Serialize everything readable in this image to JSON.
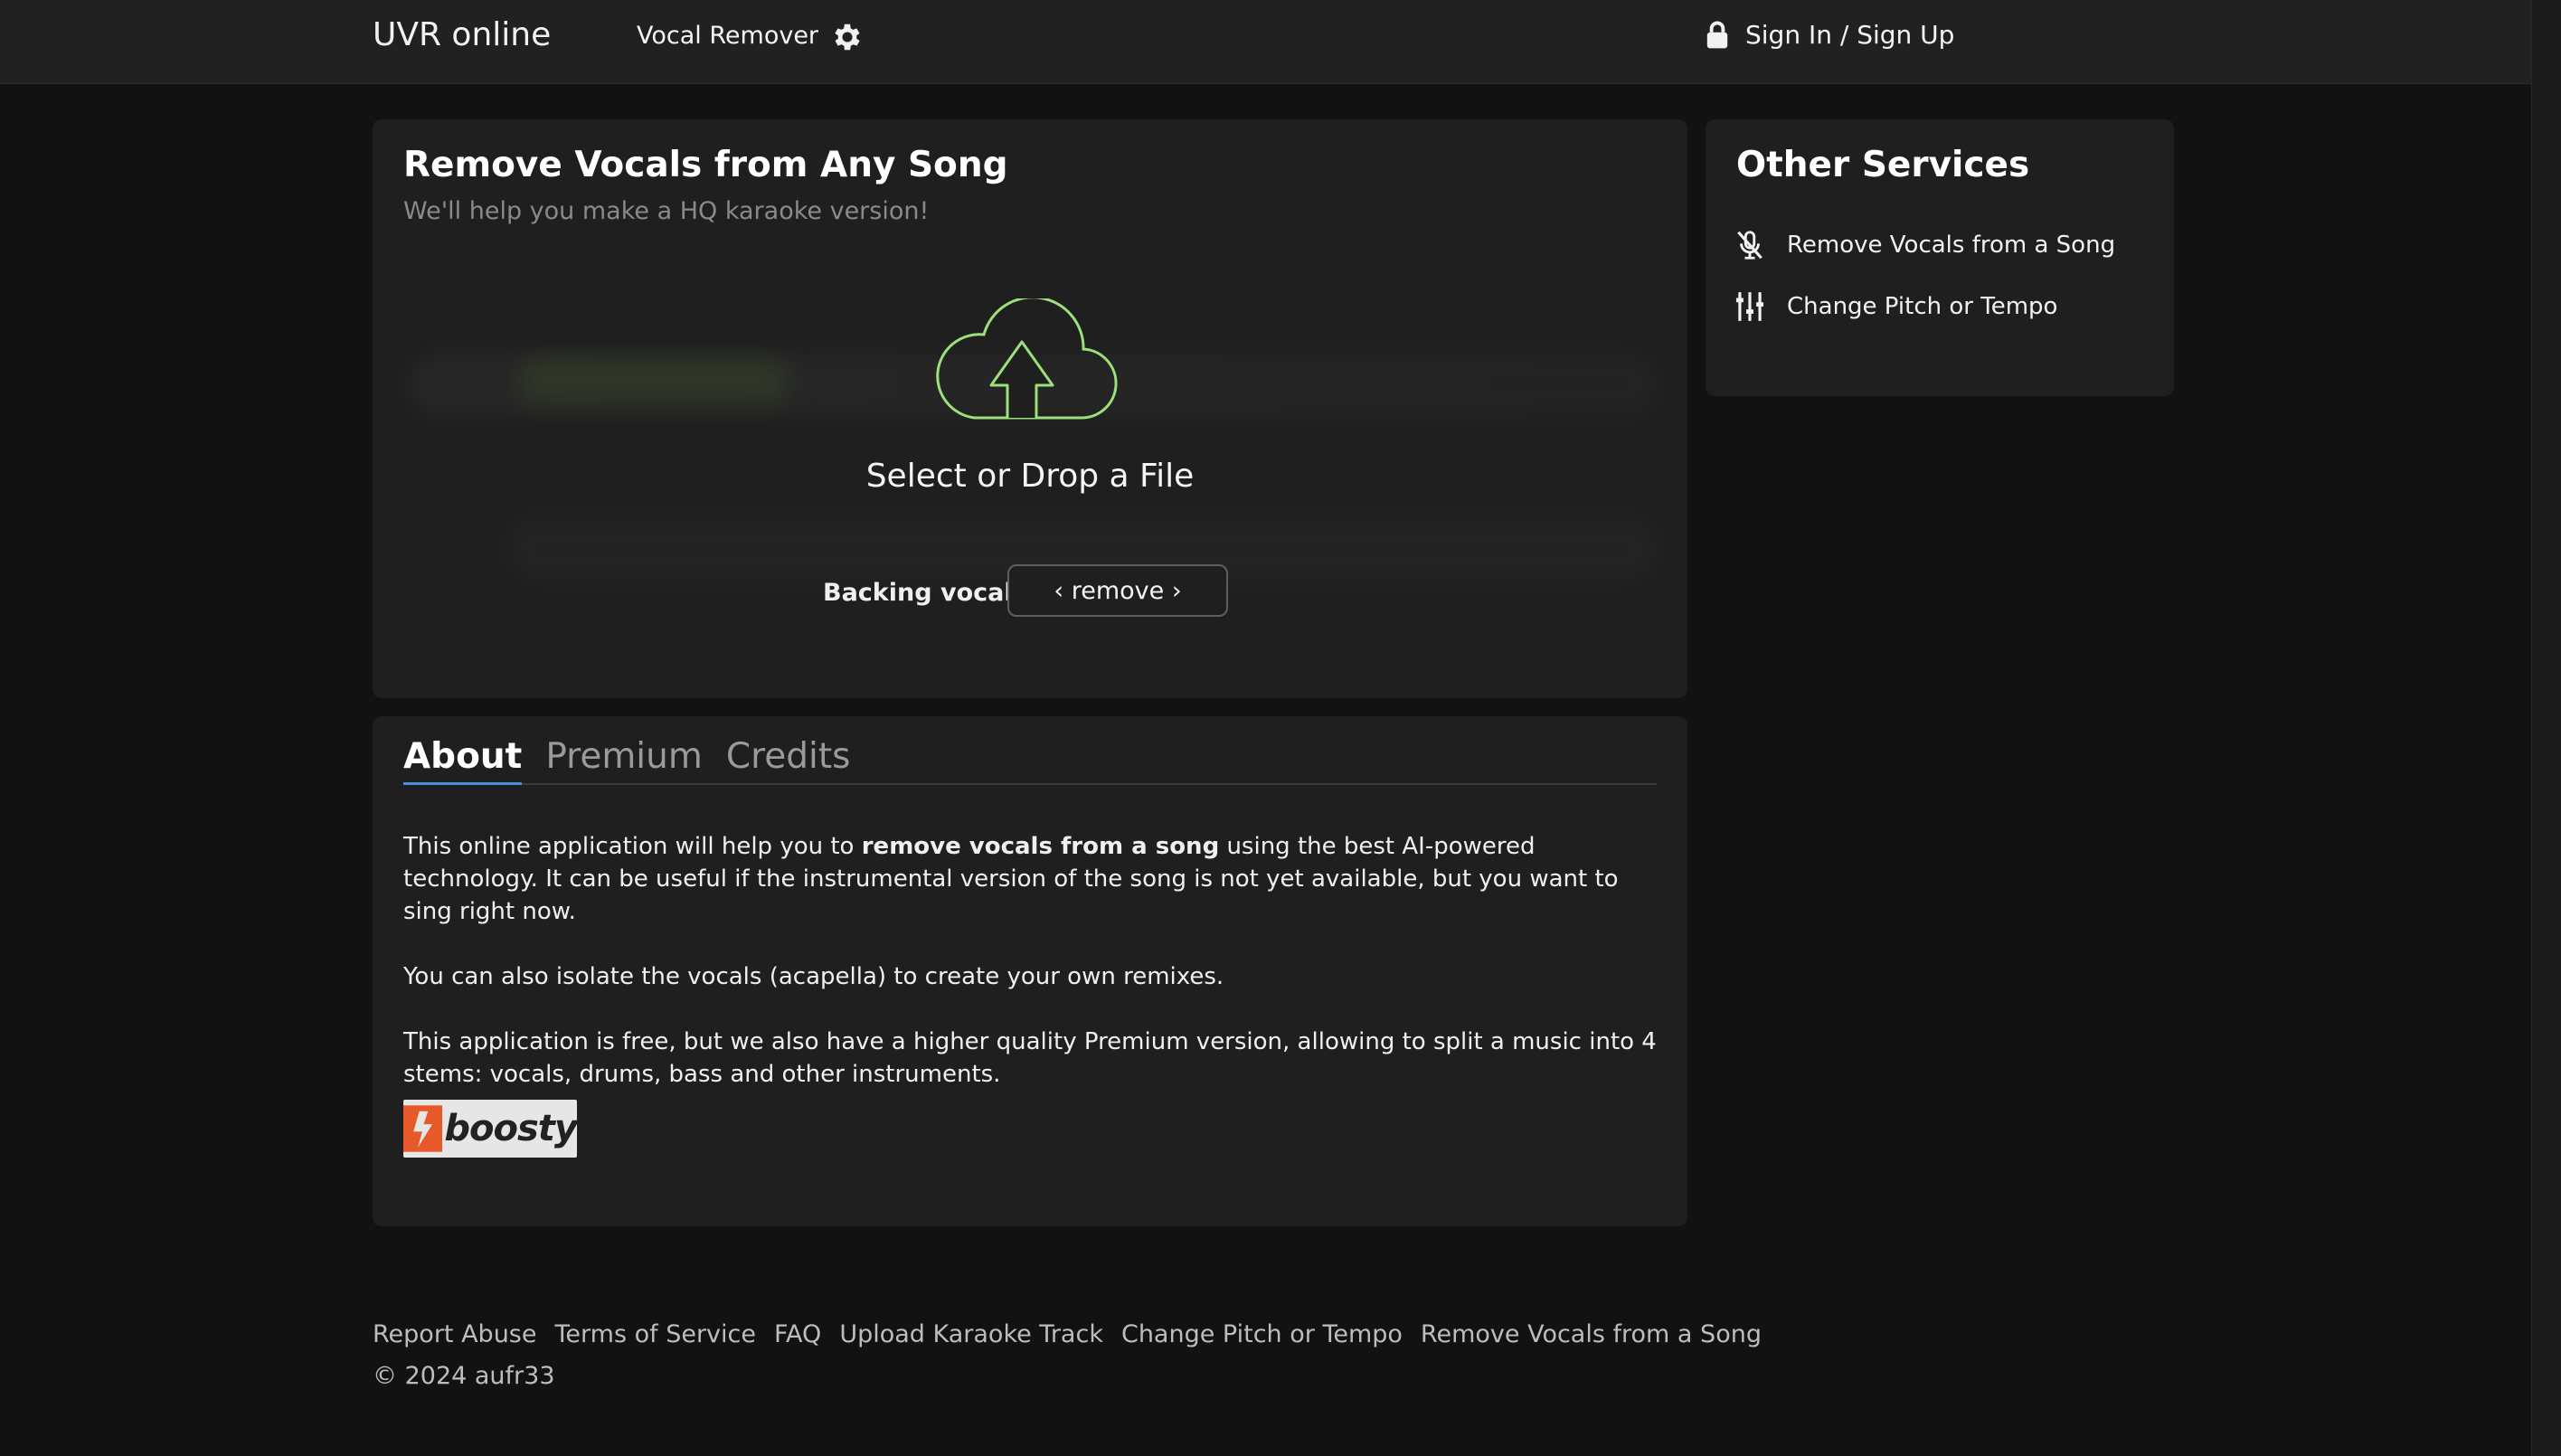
{
  "header": {
    "brand": "UVR online",
    "nav_vocal_remover": "Vocal Remover",
    "sign_in": "Sign In / Sign Up"
  },
  "main": {
    "title": "Remove Vocals from Any Song",
    "subtitle": "We'll help you make a HQ karaoke version!",
    "drop_text": "Select or Drop a File",
    "backing_vocals_label": "Backing vocals",
    "backing_vocals_value": "‹ remove ›"
  },
  "side": {
    "title": "Other Services",
    "items": [
      {
        "label": "Remove Vocals from a Song",
        "icon": "mic-off-icon"
      },
      {
        "label": "Change Pitch or Tempo",
        "icon": "sliders-icon"
      }
    ]
  },
  "about": {
    "tabs": [
      "About",
      "Premium",
      "Credits"
    ],
    "active_tab": "About",
    "p1_pre": "This online application will help you to ",
    "p1_bold": "remove vocals from a song",
    "p1_post": " using the best AI-powered technology. It can be useful if the instrumental version of the song is not yet available, but you want to sing right now.",
    "p2": "You can also isolate the vocals (acapella) to create your own remixes.",
    "p3": "This application is free, but we also have a higher quality Premium version, allowing to split a music into 4 stems: vocals, drums, bass and other instruments.",
    "boosty_text": "boosty"
  },
  "footer": {
    "links": [
      "Report Abuse",
      "Terms of Service",
      "FAQ",
      "Upload Karaoke Track",
      "Change Pitch or Tempo",
      "Remove Vocals from a Song"
    ],
    "copyright": "© 2024 aufr33"
  },
  "colors": {
    "background": "#121212",
    "card": "#1f1f1f",
    "topbar": "#212121",
    "upload_accent": "#9be07a",
    "tab_underline": "#4a90d9",
    "boosty_orange": "#e8592a"
  }
}
